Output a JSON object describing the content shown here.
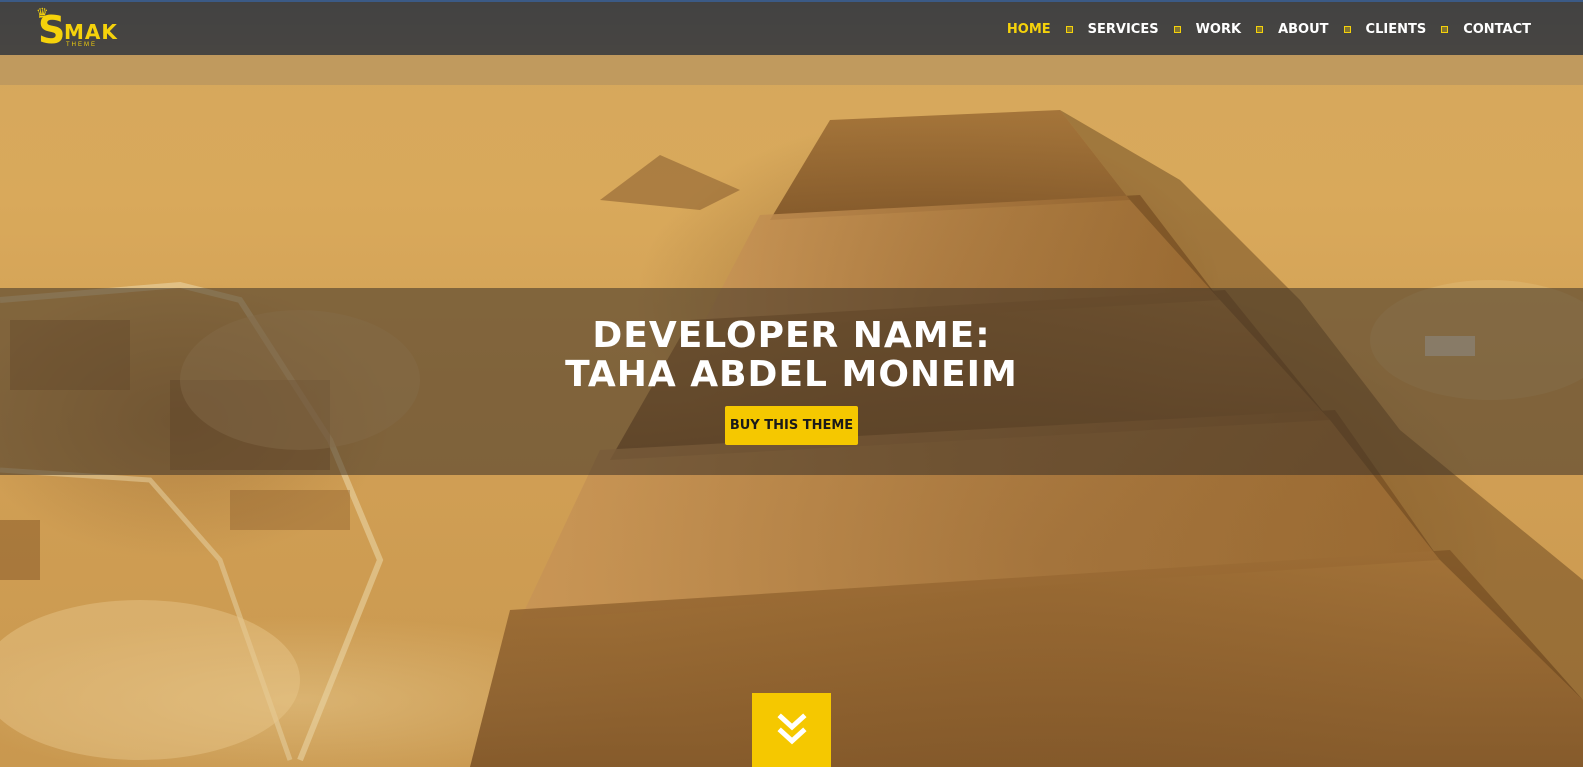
{
  "logo": {
    "letter": "S",
    "text": "MAK",
    "sub": "THEME"
  },
  "nav": {
    "items": [
      {
        "label": "HOME",
        "active": true
      },
      {
        "label": "SERVICES",
        "active": false
      },
      {
        "label": "WORK",
        "active": false
      },
      {
        "label": "ABOUT",
        "active": false
      },
      {
        "label": "CLIENTS",
        "active": false
      },
      {
        "label": "CONTACT",
        "active": false
      }
    ]
  },
  "hero": {
    "line1": "DEVELOPER NAME:",
    "line2": "TAHA ABDEL MONEIM",
    "button_label": "BUY THIS THEME"
  },
  "scroll_button": {
    "icon": "double-chevron-down-icon"
  },
  "colors": {
    "accent": "#f5c800",
    "nav_bg": "#28303c",
    "text": "#ffffff"
  }
}
